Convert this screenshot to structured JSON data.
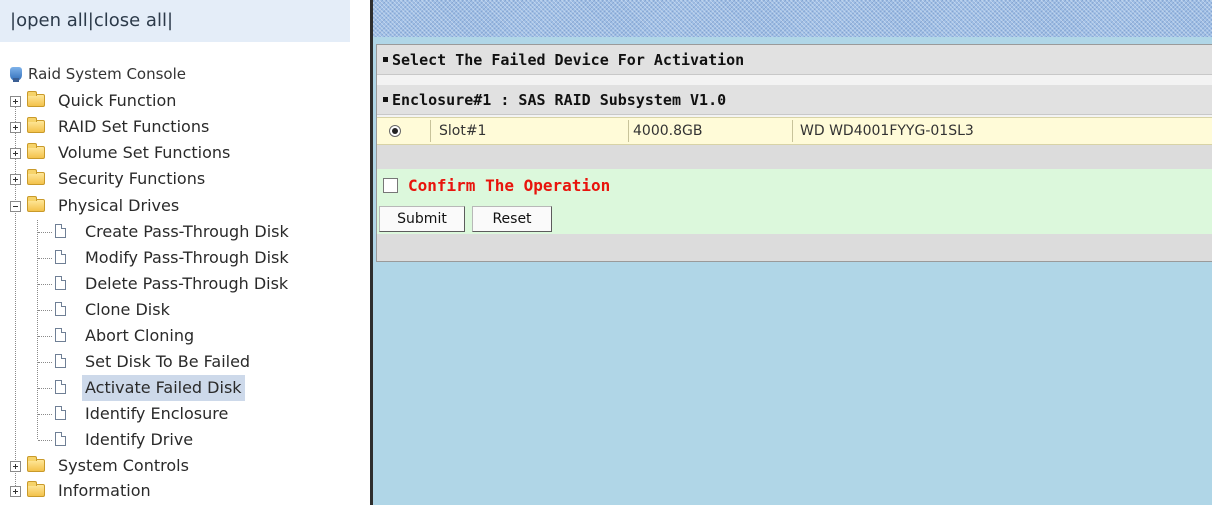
{
  "left_frame": {
    "open_close": {
      "prefix": "|",
      "open_all": "open all",
      "separator": "|",
      "close_all": "close all",
      "suffix": "|"
    },
    "root_label": "Raid System Console",
    "folders": {
      "quick_function": "Quick Function",
      "raid_set_functions": "RAID Set Functions",
      "volume_set_functions": "Volume Set Functions",
      "security_functions": "Security Functions",
      "physical_drives": "Physical Drives",
      "system_controls": "System Controls",
      "information": "Information"
    },
    "physical_drives_items": [
      "Create Pass-Through Disk",
      "Modify Pass-Through Disk",
      "Delete Pass-Through Disk",
      "Clone Disk",
      "Abort Cloning",
      "Set Disk To Be Failed",
      "Activate Failed Disk",
      "Identify Enclosure",
      "Identify Drive"
    ],
    "selected_item": "Activate Failed Disk"
  },
  "main": {
    "section_title": "Select The Failed Device For Activation",
    "enclosure_title": "Enclosure#1 : SAS RAID Subsystem V1.0",
    "devices": [
      {
        "slot": "Slot#1",
        "capacity": "4000.8GB",
        "model": "WD WD4001FYYG-01SL3",
        "selected": true
      }
    ],
    "confirm_label": "Confirm The Operation",
    "confirm_checked": false,
    "submit_label": "Submit",
    "reset_label": "Reset"
  },
  "colors": {
    "confirm_text": "#e8140c",
    "right_background": "#b0d6e7",
    "green_rows": "#dcf8dc",
    "device_row": "#fffbd8",
    "selected_tree_item": "#cdd9ea"
  }
}
